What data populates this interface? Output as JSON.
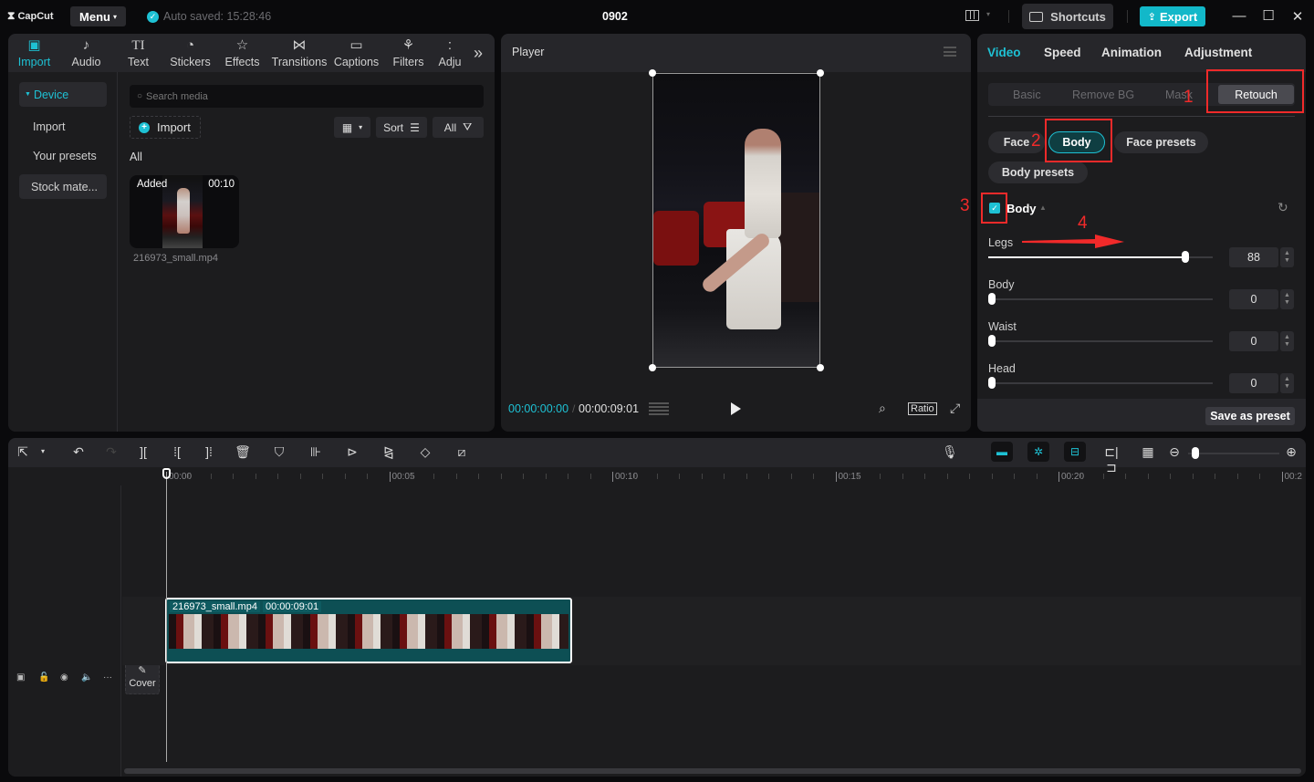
{
  "titlebar": {
    "app_name": "CapCut",
    "menu_label": "Menu",
    "autosave": "Auto saved: 15:28:46",
    "project_title": "0902",
    "shortcuts_label": "Shortcuts",
    "export_label": "Export"
  },
  "media": {
    "tabs": [
      {
        "label": "Import",
        "icon": "import-icon"
      },
      {
        "label": "Audio",
        "icon": "audio-icon"
      },
      {
        "label": "Text",
        "icon": "text-icon"
      },
      {
        "label": "Stickers",
        "icon": "stickers-icon"
      },
      {
        "label": "Effects",
        "icon": "effects-icon"
      },
      {
        "label": "Transitions",
        "icon": "transitions-icon"
      },
      {
        "label": "Captions",
        "icon": "captions-icon"
      },
      {
        "label": "Filters",
        "icon": "filters-icon"
      },
      {
        "label": "Adju",
        "icon": "adjustment-icon"
      }
    ],
    "sidebar": {
      "device": "Device",
      "items": [
        "Import",
        "Your presets",
        "Stock mate..."
      ]
    },
    "search_placeholder": "Search media",
    "import_label": "Import",
    "sort_label": "Sort",
    "filter_label": "All",
    "section_label": "All",
    "item": {
      "badge": "Added",
      "duration": "00:10",
      "filename": "216973_small.mp4"
    }
  },
  "player": {
    "title": "Player",
    "current_time": "00:00:00:00",
    "separator": "/",
    "total_time": "00:00:09:01",
    "ratio_label": "Ratio"
  },
  "properties": {
    "tabs": [
      "Video",
      "Speed",
      "Animation",
      "Adjustment"
    ],
    "active_tab": "Video",
    "subtabs": [
      "Basic",
      "Remove BG",
      "Mask",
      "Retouch"
    ],
    "active_subtab": "Retouch",
    "pills": [
      "Face",
      "Body",
      "Face presets",
      "Body presets"
    ],
    "active_pill": "Body",
    "section_title": "Body",
    "section_checked": true,
    "sliders": [
      {
        "label": "Legs",
        "value": 88,
        "max": 100
      },
      {
        "label": "Body",
        "value": 0,
        "max": 100
      },
      {
        "label": "Waist",
        "value": 0,
        "max": 100
      },
      {
        "label": "Head",
        "value": 0,
        "max": 100
      }
    ],
    "save_preset_label": "Save as preset",
    "annotations": [
      "1",
      "2",
      "3",
      "4"
    ],
    "annotation_color": "#f12a2a"
  },
  "timeline": {
    "ruler_labels": [
      "00:00",
      "00:05",
      "00:10",
      "00:15",
      "00:20",
      "00:2"
    ],
    "clip": {
      "name": "216973_small.mp4",
      "duration": "00:00:09:01"
    },
    "cover_label": "Cover",
    "zoom_level": 0.1
  },
  "colors": {
    "accent": "#1ec1d4",
    "panel": "#1c1c1e",
    "clip": "#0d4f54"
  }
}
